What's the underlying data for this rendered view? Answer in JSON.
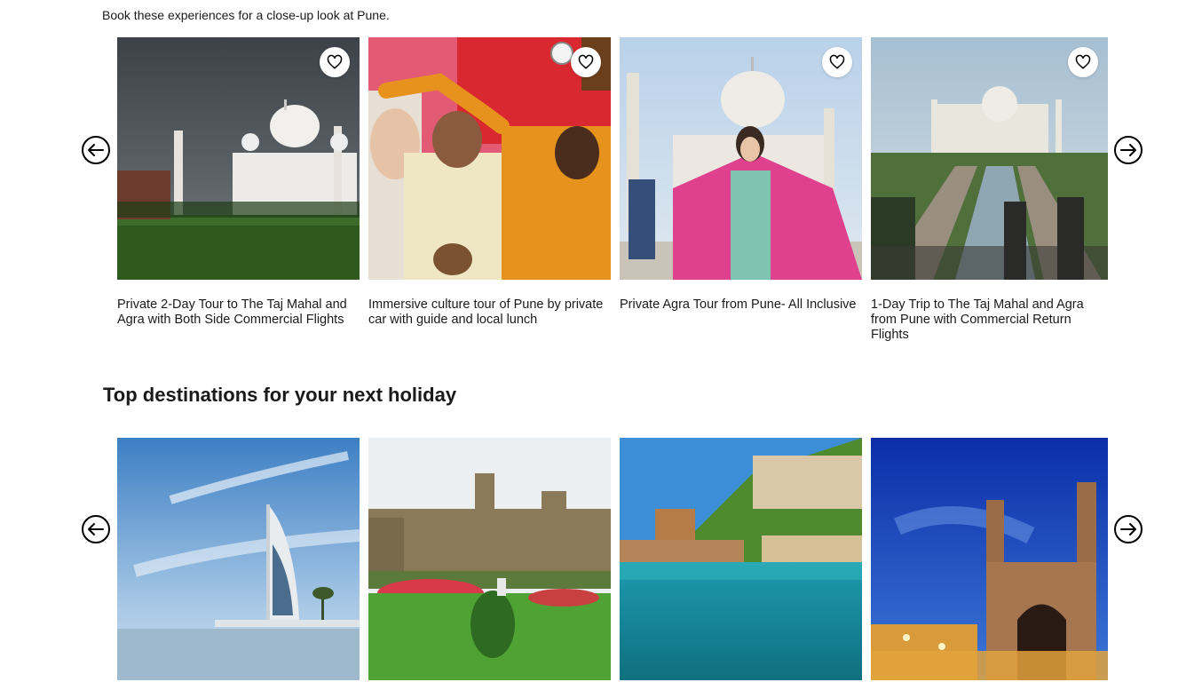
{
  "experiences": {
    "intro_text": "Book these experiences for a close-up look at Pune.",
    "prev_icon": "arrow-left-circle-icon",
    "next_icon": "arrow-right-circle-icon",
    "wishlist_icon": "heart-outline-icon",
    "cards": [
      {
        "title": "Private 2-Day Tour to The Taj Mahal and Agra with Both Side Commercial Flights"
      },
      {
        "title": "Immersive culture tour of Pune by private car with guide and local lunch"
      },
      {
        "title": "Private Agra Tour from Pune- All Inclusive"
      },
      {
        "title": "1-Day Trip to The Taj Mahal and Agra from Pune with Commercial Return Flights"
      }
    ]
  },
  "destinations": {
    "heading": "Top destinations for your next holiday",
    "prev_icon": "arrow-left-circle-icon",
    "next_icon": "arrow-right-circle-icon"
  }
}
